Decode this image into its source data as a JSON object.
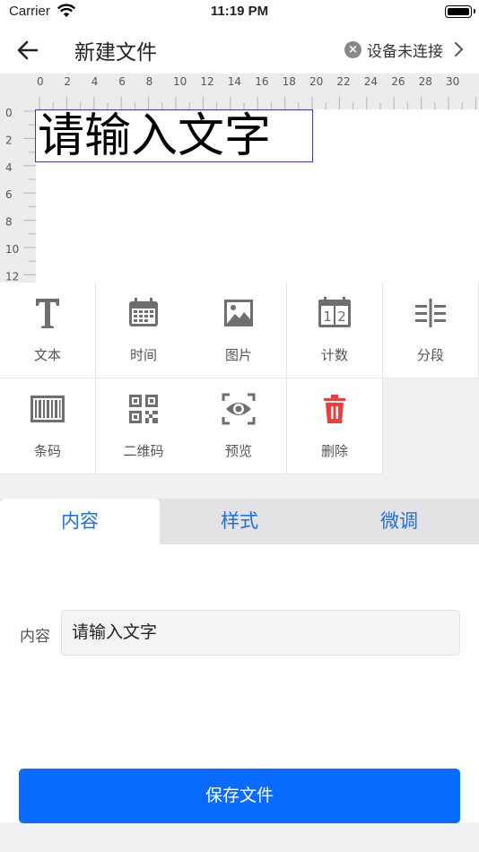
{
  "status_bar": {
    "carrier": "Carrier",
    "time": "11:19 PM"
  },
  "nav": {
    "title": "新建文件",
    "device_status": "设备未连接",
    "back_icon": "arrow-left-icon",
    "chevron_icon": "chevron-right-icon"
  },
  "ruler": {
    "top_labels": [
      "0",
      "2",
      "4",
      "6",
      "8",
      "10",
      "12",
      "14",
      "16",
      "18",
      "20",
      "22",
      "24",
      "26",
      "28",
      "30"
    ],
    "left_labels": [
      "0",
      "2",
      "4",
      "6",
      "8",
      "10",
      "12"
    ]
  },
  "canvas": {
    "text": "请输入文字"
  },
  "tools": [
    {
      "label": "文本",
      "icon": "text-icon"
    },
    {
      "label": "时间",
      "icon": "calendar-icon"
    },
    {
      "label": "图片",
      "icon": "image-icon"
    },
    {
      "label": "计数",
      "icon": "counter-icon"
    },
    {
      "label": "分段",
      "icon": "segment-icon"
    },
    {
      "label": "条码",
      "icon": "barcode-icon"
    },
    {
      "label": "二维码",
      "icon": "qrcode-icon"
    },
    {
      "label": "预览",
      "icon": "eye-icon"
    },
    {
      "label": "删除",
      "icon": "trash-icon"
    }
  ],
  "tabs": [
    {
      "label": "内容",
      "active": true
    },
    {
      "label": "样式",
      "active": false
    },
    {
      "label": "微调",
      "active": false
    }
  ],
  "content_form": {
    "label": "内容",
    "value": "请输入文字"
  },
  "save_button": {
    "label": "保存文件"
  },
  "colors": {
    "accent": "#0a6cff",
    "tab_text": "#1a6fe6",
    "delete_icon": "#f23b3b",
    "selection_border": "#3737d8"
  }
}
